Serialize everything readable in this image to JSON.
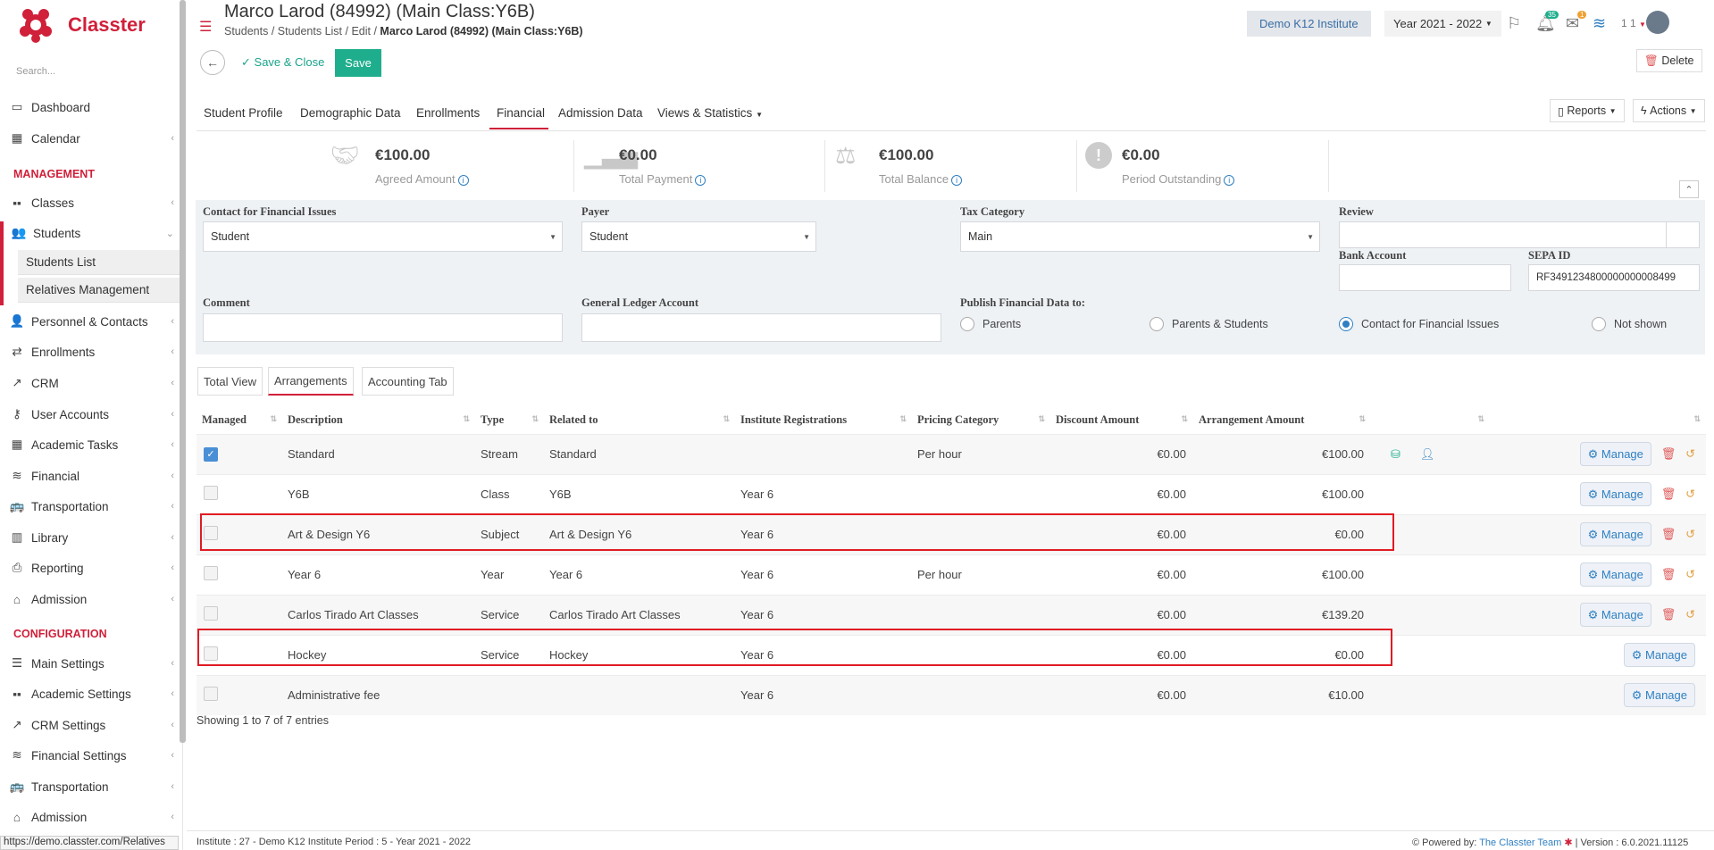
{
  "app": {
    "name": "Classter",
    "brand_color": "#d0203a",
    "accent": "#1fae8d",
    "link": "#2f7fc1"
  },
  "sidebar": {
    "search_placeholder": "Search...",
    "items": [
      {
        "label": "Dashboard",
        "icon": "laptop-icon"
      },
      {
        "label": "Calendar",
        "icon": "calendar-icon"
      },
      {
        "label": "Classes",
        "icon": "classes-icon"
      },
      {
        "label": "Students",
        "icon": "students-icon"
      },
      {
        "label": "Personnel & Contacts",
        "icon": "person-icon"
      },
      {
        "label": "Enrollments",
        "icon": "exchange-icon"
      },
      {
        "label": "CRM",
        "icon": "crm-icon"
      },
      {
        "label": "User Accounts",
        "icon": "key-icon"
      },
      {
        "label": "Academic Tasks",
        "icon": "grid-icon"
      },
      {
        "label": "Financial",
        "icon": "coins-icon"
      },
      {
        "label": "Transportation",
        "icon": "bus-icon"
      },
      {
        "label": "Library",
        "icon": "books-icon"
      },
      {
        "label": "Reporting",
        "icon": "printer-icon"
      },
      {
        "label": "Admission",
        "icon": "institution-icon"
      }
    ],
    "sections": {
      "management": "MANAGEMENT",
      "configuration": "CONFIGURATION"
    },
    "sub_items": [
      "Students List",
      "Relatives Management"
    ],
    "config_items": [
      {
        "label": "Main Settings",
        "icon": "sliders-icon"
      },
      {
        "label": "Academic Settings",
        "icon": "classes-icon"
      },
      {
        "label": "CRM Settings",
        "icon": "crm-icon"
      },
      {
        "label": "Financial Settings",
        "icon": "coins-icon"
      },
      {
        "label": "Transportation",
        "icon": "bus-icon"
      },
      {
        "label": "Admission",
        "icon": "institution-icon"
      }
    ]
  },
  "status_url": "https://demo.classter.com/Relatives",
  "header": {
    "title": "Marco Larod (84992) (Main Class:Y6B)",
    "breadcrumb": [
      "Students",
      "Students List",
      "Edit",
      "Marco Larod (84992) (Main Class:Y6B)"
    ],
    "institute": "Demo K12 Institute",
    "year": "Year 2021 - 2022",
    "notif_count": "35",
    "mail_count": "1",
    "user_short": "1 1"
  },
  "toolbar": {
    "save_close": "Save & Close",
    "save": "Save",
    "delete": "Delete"
  },
  "tabs": [
    "Student Profile",
    "Demographic Data",
    "Enrollments",
    "Financial",
    "Admission Data",
    "Views & Statistics"
  ],
  "right_buttons": {
    "reports": "Reports",
    "actions": "Actions"
  },
  "summary": [
    {
      "amount": "€100.00",
      "label": "Agreed Amount"
    },
    {
      "amount": "€0.00",
      "label": "Total Payment"
    },
    {
      "amount": "€100.00",
      "label": "Total Balance"
    },
    {
      "amount": "€0.00",
      "label": "Period Outstanding"
    }
  ],
  "form": {
    "contact_label": "Contact for Financial Issues",
    "contact_value": "Student",
    "payer_label": "Payer",
    "payer_value": "Student",
    "tax_label": "Tax Category",
    "tax_value": "Main",
    "review_label": "Review",
    "bank_label": "Bank Account",
    "sepa_label": "SEPA ID",
    "sepa_value": "RF3491234800000000008499",
    "comment_label": "Comment",
    "gl_label": "General Ledger Account",
    "publish_label": "Publish Financial Data to:",
    "publish_options": [
      "Parents",
      "Parents & Students",
      "Contact for Financial Issues",
      "Not shown"
    ],
    "publish_selected": "Contact for Financial Issues"
  },
  "subtabs": [
    "Total View",
    "Arrangements",
    "Accounting Tab"
  ],
  "table": {
    "headers": [
      "Managed",
      "Description",
      "Type",
      "Related to",
      "Institute Registrations",
      "Pricing Category",
      "Discount Amount",
      "Arrangement Amount"
    ],
    "rows": [
      {
        "managed": true,
        "description": "Standard",
        "type": "Stream",
        "related": "Standard",
        "registrations": "",
        "pricing": "Per hour",
        "discount": "€0.00",
        "amount": "€100.00",
        "actions": [
          "Manage"
        ]
      },
      {
        "managed": false,
        "description": "Y6B",
        "type": "Class",
        "related": "Y6B",
        "registrations": "Year 6",
        "pricing": "",
        "discount": "€0.00",
        "amount": "€100.00",
        "actions": [
          "Manage"
        ]
      },
      {
        "managed": false,
        "description": "Art & Design Y6",
        "type": "Subject",
        "related": "Art & Design Y6",
        "registrations": "Year 6",
        "pricing": "",
        "discount": "€0.00",
        "amount": "€0.00",
        "actions": [
          "Manage"
        ]
      },
      {
        "managed": false,
        "description": "Year 6",
        "type": "Year",
        "related": "Year 6",
        "registrations": "Year 6",
        "pricing": "Per hour",
        "discount": "€0.00",
        "amount": "€100.00",
        "actions": [
          "Manage"
        ]
      },
      {
        "managed": false,
        "description": "Carlos Tirado Art Classes",
        "type": "Service",
        "related": "Carlos Tirado Art Classes",
        "registrations": "Year 6",
        "pricing": "",
        "discount": "€0.00",
        "amount": "€139.20",
        "actions": [
          "Manage"
        ]
      },
      {
        "managed": false,
        "description": "Hockey",
        "type": "Service",
        "related": "Hockey",
        "registrations": "Year 6",
        "pricing": "",
        "discount": "€0.00",
        "amount": "€0.00",
        "actions": [
          "Manage"
        ]
      },
      {
        "managed": false,
        "description": "Administrative fee",
        "type": "",
        "related": "",
        "registrations": "Year 6",
        "pricing": "",
        "discount": "€0.00",
        "amount": "€10.00",
        "actions": [
          "Manage"
        ]
      }
    ],
    "showing": "Showing 1 to 7 of 7 entries"
  },
  "footer": {
    "left": "Institute : 27 - Demo K12 Institute Period : 5 - Year 2021 - 2022",
    "powered": "Powered by:",
    "team": "The Classter Team",
    "version": "| Version : 6.0.2021.11125"
  }
}
